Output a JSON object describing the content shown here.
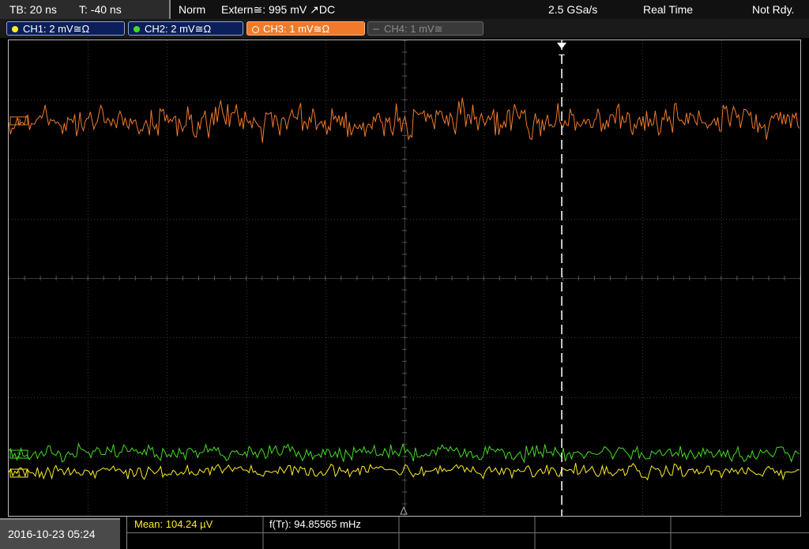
{
  "topbar": {
    "timebase": "TB: 20 ns",
    "trigger_time": "T: -40 ns",
    "trigger_mode": "Norm",
    "trigger_source": "Extern≅: 995 mV ↗DC",
    "sample_rate": "2.5 GSa/s",
    "acq_mode": "Real Time",
    "status": "Not Rdy."
  },
  "channels": [
    {
      "label": "CH1: 2 mV≅Ω",
      "color": "#ffee22"
    },
    {
      "label": "CH2: 2 mV≅Ω",
      "color": "#44dd22"
    },
    {
      "label": "CH3: 1 mV≅Ω",
      "color": "#f07a2a"
    },
    {
      "label": "CH4: 1 mV≅",
      "color": "#777777"
    }
  ],
  "plot": {
    "trigger_marker": "T",
    "ch3_marker": "3",
    "ch2_marker": "2",
    "ch1_marker": "1"
  },
  "bottombar": {
    "datetime": "2016-10-23 05:24",
    "mean_label": "Mean: 104.24 µV",
    "freq_label": "f(Tr): 94.85565 mHz"
  }
}
